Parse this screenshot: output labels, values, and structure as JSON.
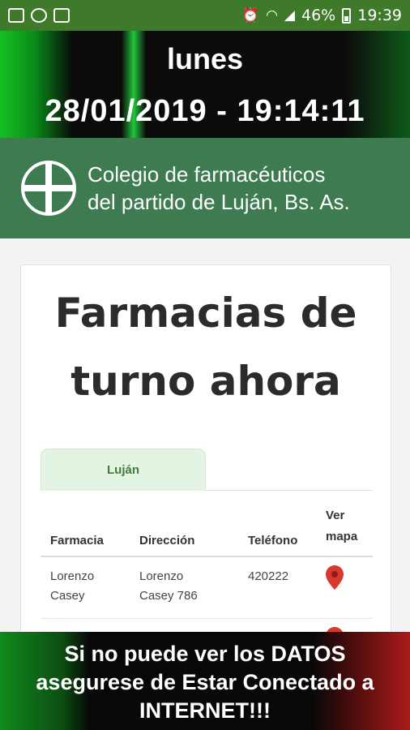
{
  "status_bar": {
    "left_icons": [
      "gallery-icon",
      "whatsapp-icon",
      "mail-icon"
    ],
    "right_icons": [
      "alarm-icon",
      "wifi-icon",
      "signal-icon",
      "battery-icon"
    ],
    "battery": "46%",
    "time": "19:39"
  },
  "header": {
    "day": "lunes",
    "datetime": "28/01/2019 - 19:14:11"
  },
  "college": {
    "icon": "pharmacy-cross-icon",
    "line1": "Colegio de farmacéuticos",
    "line2": "del partido de Luján, Bs. As."
  },
  "card": {
    "title_line1": "Farmacias de",
    "title_line2": "turno ahora",
    "tab": "Luján",
    "columns": [
      "Farmacia",
      "Dirección",
      "Teléfono",
      "Ver",
      "mapa"
    ],
    "rows": [
      {
        "farmacia_1": "Lorenzo",
        "farmacia_2": "Casey",
        "direccion_1": "Lorenzo",
        "direccion_2": "Casey 786",
        "telefono": "420222",
        "map_icon": "map-pin-icon"
      }
    ]
  },
  "banner": {
    "line1": "Si no puede ver los DATOS",
    "line2": "asegurese de Estar Conectado a",
    "line3": "INTERNET!!!"
  },
  "colors": {
    "status_bar": "#3f7a2b",
    "college_bg": "#3e7b51",
    "tab_bg": "#e4f4e2",
    "tab_text": "#3c7d3a",
    "pin": "#d9382c"
  }
}
